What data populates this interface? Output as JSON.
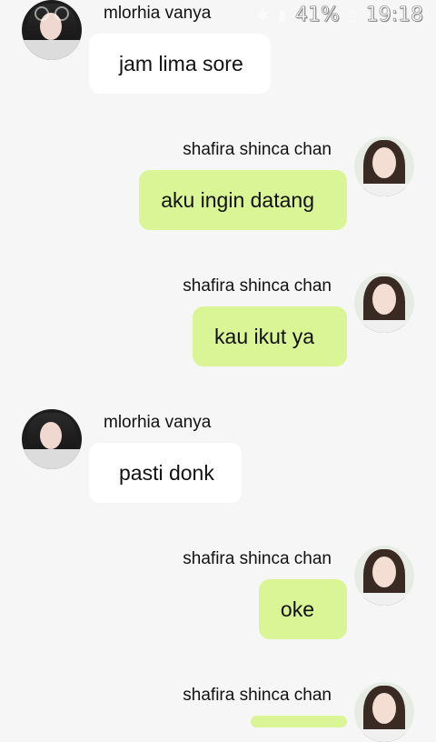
{
  "status_bar": {
    "battery": "41%",
    "time": "19:18"
  },
  "colors": {
    "background": "#f6f6f6",
    "incoming_bubble": "#ffffff",
    "outgoing_bubble": "#d9f595"
  },
  "messages": [
    {
      "direction": "incoming",
      "sender": "mlorhia  vanya",
      "text": "jam lima sore"
    },
    {
      "direction": "outgoing",
      "sender": "shafira shinca chan",
      "text": "aku ingin datang"
    },
    {
      "direction": "outgoing",
      "sender": "shafira shinca chan",
      "text": "kau ikut ya"
    },
    {
      "direction": "incoming",
      "sender": "mlorhia  vanya",
      "text": "pasti donk"
    },
    {
      "direction": "outgoing",
      "sender": "shafira shinca chan",
      "text": "oke"
    },
    {
      "direction": "outgoing",
      "sender": "shafira shinca chan",
      "text": ""
    }
  ]
}
